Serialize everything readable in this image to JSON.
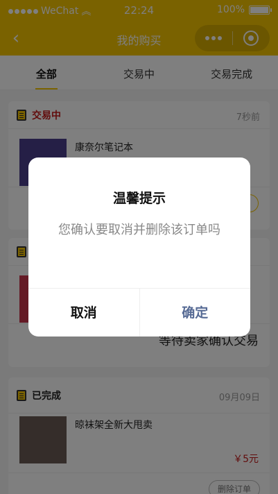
{
  "status_bar": {
    "carrier": "WeChat",
    "time": "22:24",
    "battery": "100%"
  },
  "nav": {
    "title": "我的购买"
  },
  "tabs": [
    "全部",
    "交易中",
    "交易完成"
  ],
  "orders": [
    {
      "status": "交易中",
      "time": "7秒前",
      "item": "康奈尔笔记本"
    },
    {
      "status": "",
      "time": "",
      "item": "",
      "footer": "等待卖家确认交易"
    },
    {
      "status": "已完成",
      "time": "09月09日",
      "item": "晾袜架全新大甩卖",
      "price": "￥5元",
      "action": "删除订单"
    }
  ],
  "modal": {
    "title": "温馨提示",
    "message": "您确认要取消并删除该订单吗",
    "cancel": "取消",
    "confirm": "确定"
  }
}
